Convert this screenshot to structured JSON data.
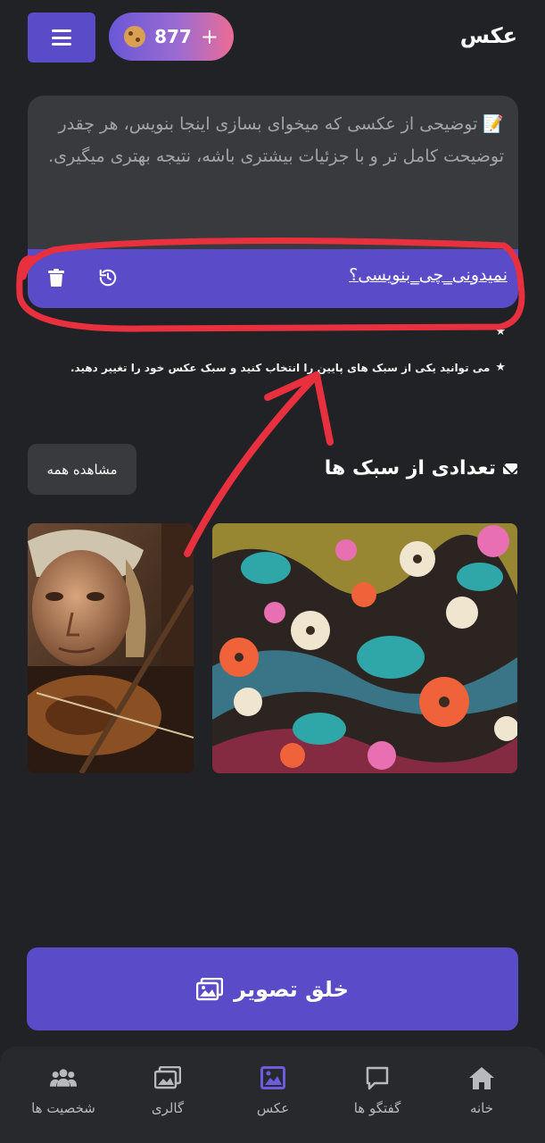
{
  "header": {
    "title": "عکس",
    "credits": "877",
    "credits_plus": "+",
    "cookie_icon": "cookie-icon"
  },
  "prompt": {
    "placeholder": "📝 توضیحی از عکسی که میخوای بسازی اینجا بنویس، هر چقدر توضیحت کامل تر و با جزئیات بیشتری باشه، نتیجه بهتری میگیری.",
    "suggest_link": "نمیدونی_چی_بنویسی؟"
  },
  "tips": {
    "tip_2": "می توانید یکی از سبک های پایین را انتخاب کنید و سبک عکس خود را تغییر دهید."
  },
  "styles": {
    "title": "تعدادی از سبک ها",
    "view_all": "مشاهده همه"
  },
  "create_button": "خلق تصویر",
  "nav": {
    "items": [
      {
        "label": "خانه",
        "icon": "home-icon"
      },
      {
        "label": "گفتگو ها",
        "icon": "chat-icon"
      },
      {
        "label": "عکس",
        "icon": "image-icon",
        "active": true
      },
      {
        "label": "گالری",
        "icon": "gallery-icon"
      },
      {
        "label": "شخصیت ها",
        "icon": "people-icon"
      }
    ]
  },
  "colors": {
    "accent": "#5a4bc9",
    "active_nav": "#6b5ce0",
    "annotation": "#e8303f"
  }
}
